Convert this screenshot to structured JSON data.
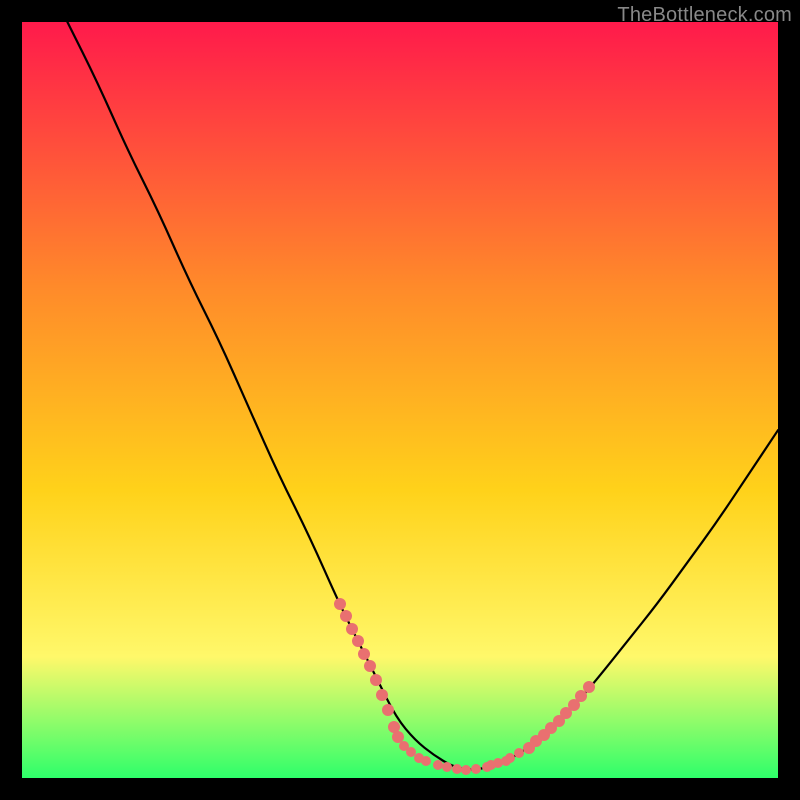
{
  "watermark": "TheBottleneck.com",
  "colors": {
    "gradient_top": "#ff1a4b",
    "gradient_mid1": "#ff6a2a",
    "gradient_mid2": "#ffd21a",
    "gradient_mid3": "#fff86a",
    "gradient_bottom": "#2eff6a",
    "curve": "#000000",
    "dots": "#e97070",
    "frame_bg": "#000000"
  },
  "chart_data": {
    "type": "line",
    "title": "",
    "xlabel": "",
    "ylabel": "",
    "xlim": [
      0,
      100
    ],
    "ylim": [
      0,
      100
    ],
    "series": [
      {
        "name": "bottleneck-curve",
        "x": [
          6,
          10,
          14,
          18,
          22,
          26,
          30,
          34,
          38,
          42,
          44.5,
          47,
          49.5,
          52,
          54.5,
          57,
          59.5,
          62,
          64.5,
          67,
          70,
          73,
          76,
          80,
          84,
          88,
          92,
          96,
          100
        ],
        "values": [
          100,
          92,
          83,
          75,
          66,
          58,
          49,
          40,
          32,
          23,
          18,
          13,
          8,
          5,
          3,
          1.5,
          1,
          1.5,
          2.5,
          4,
          6.5,
          9.5,
          13,
          18,
          23,
          28.5,
          34,
          40,
          46
        ]
      }
    ],
    "highlight_points_left": {
      "x": [
        42.0,
        42.8,
        43.6,
        44.4,
        45.2,
        46.0,
        46.8,
        47.6,
        48.4,
        49.2,
        49.8
      ],
      "y": [
        23.0,
        21.4,
        19.7,
        18.1,
        16.4,
        14.8,
        12.9,
        11.0,
        9.0,
        6.8,
        5.4
      ]
    },
    "highlight_points_bottom": {
      "x": [
        50.5,
        51.5,
        52.5,
        53.5,
        55.0,
        56.2,
        57.5,
        58.7,
        60.0,
        61.5,
        63.0,
        64.5,
        65.8,
        64,
        62
      ],
      "y": [
        4.2,
        3.4,
        2.7,
        2.2,
        1.7,
        1.4,
        1.2,
        1.1,
        1.2,
        1.5,
        2.0,
        2.6,
        3.3,
        2.3,
        1.7
      ]
    },
    "highlight_points_right": {
      "x": [
        67.0,
        68.0,
        69.0,
        70.0,
        71.0,
        72.0,
        73.0,
        74.0,
        75.0
      ],
      "y": [
        4.0,
        4.9,
        5.7,
        6.6,
        7.6,
        8.6,
        9.7,
        10.9,
        12.1
      ]
    }
  }
}
